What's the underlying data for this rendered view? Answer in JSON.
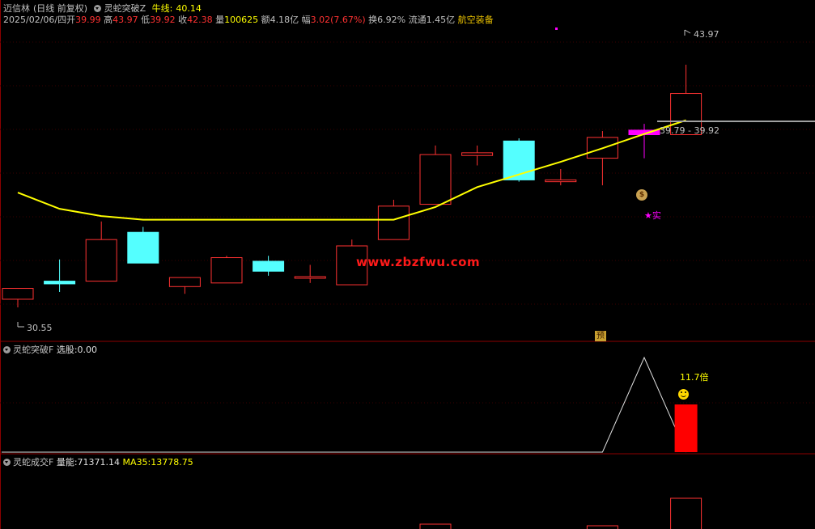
{
  "main": {
    "stock_name": "迈信林",
    "period": "(日线 前复权)",
    "indicator_name": "灵蛇突破Z",
    "bull_line_label": "牛线:",
    "bull_line_value": "40.14",
    "date": "2025/02/06/四",
    "open_label": "开",
    "open_value": "39.99",
    "high_label": "高",
    "high_value": "43.97",
    "low_label": "低",
    "low_value": "39.92",
    "close_label": "收",
    "close_value": "42.38",
    "volume_label": "量",
    "volume_value": "100625",
    "amount_label": "额",
    "amount_value": "4.18亿",
    "change_label": "幅",
    "change_value": "3.02(7.67%)",
    "turnover_label": "换",
    "turnover_value": "6.92%",
    "float_label": "流通",
    "float_value": "1.45亿",
    "sector": "航空装备",
    "high_marker": "43.97",
    "low_marker": "30.55",
    "range_marker": "39.79 - 39.92",
    "watermark": "www.zbzfwu.com",
    "signal_text": "实",
    "bottom_tag": "预"
  },
  "panel2": {
    "indicator_name": "灵蛇突破F",
    "select_label": "选股:",
    "select_value": "0.00",
    "annotation": "11.7倍"
  },
  "panel3": {
    "indicator_name": "灵蛇成交F",
    "volume_label": "量能:",
    "volume_value": "71371.14",
    "ma_label": "MA35:",
    "ma_value": "13778.75"
  },
  "colors": {
    "up": "#ff3232",
    "down": "#54ffff",
    "bull_line": "#ffff00",
    "grid": "#8b0000",
    "signal": "#ff00ff"
  },
  "chart_data": {
    "type": "candlestick",
    "candles": [
      {
        "o": 31.6,
        "c": 31.0,
        "h": 31.6,
        "l": 30.55,
        "dir": "up"
      },
      {
        "o": 32.0,
        "c": 31.85,
        "h": 33.2,
        "l": 31.4,
        "dir": "down"
      },
      {
        "o": 32.0,
        "c": 34.3,
        "h": 35.3,
        "l": 32.0,
        "dir": "up"
      },
      {
        "o": 34.7,
        "c": 33.0,
        "h": 35.0,
        "l": 33.0,
        "dir": "down"
      },
      {
        "o": 31.7,
        "c": 32.2,
        "h": 32.2,
        "l": 31.3,
        "dir": "up"
      },
      {
        "o": 31.9,
        "c": 33.3,
        "h": 33.4,
        "l": 31.9,
        "dir": "up"
      },
      {
        "o": 33.1,
        "c": 32.55,
        "h": 33.4,
        "l": 32.3,
        "dir": "down"
      },
      {
        "o": 32.25,
        "c": 32.25,
        "h": 32.9,
        "l": 31.9,
        "dir": "up"
      },
      {
        "o": 31.8,
        "c": 33.95,
        "h": 34.3,
        "l": 31.8,
        "dir": "up"
      },
      {
        "o": 34.3,
        "c": 36.15,
        "h": 36.5,
        "l": 34.3,
        "dir": "up"
      },
      {
        "o": 36.25,
        "c": 39.0,
        "h": 39.5,
        "l": 36.25,
        "dir": "up"
      },
      {
        "o": 38.95,
        "c": 39.1,
        "h": 39.5,
        "l": 38.4,
        "dir": "up"
      },
      {
        "o": 39.75,
        "c": 37.6,
        "h": 39.9,
        "l": 37.5,
        "dir": "down"
      },
      {
        "o": 37.5,
        "c": 37.6,
        "h": 38.2,
        "l": 37.3,
        "dir": "up"
      },
      {
        "o": 38.8,
        "c": 39.95,
        "h": 40.3,
        "l": 37.3,
        "dir": "up"
      },
      {
        "o": 40.35,
        "c": 40.1,
        "h": 40.7,
        "l": 38.8,
        "dir": "signal"
      },
      {
        "o": 40.1,
        "c": 42.38,
        "h": 43.97,
        "l": 40.1,
        "dir": "up"
      }
    ],
    "bull_line": [
      36.9,
      36.0,
      35.6,
      35.4,
      35.4,
      35.4,
      35.4,
      35.4,
      35.4,
      35.4,
      36.1,
      37.2,
      37.9,
      38.6,
      39.35,
      40.14,
      40.9
    ],
    "select_signal": [
      0,
      0,
      0,
      0,
      0,
      0,
      0,
      0,
      0,
      0,
      0,
      0,
      0,
      0,
      0,
      1,
      0
    ],
    "volume_ratio_bar": {
      "index": 16,
      "label": "11.7倍"
    }
  }
}
